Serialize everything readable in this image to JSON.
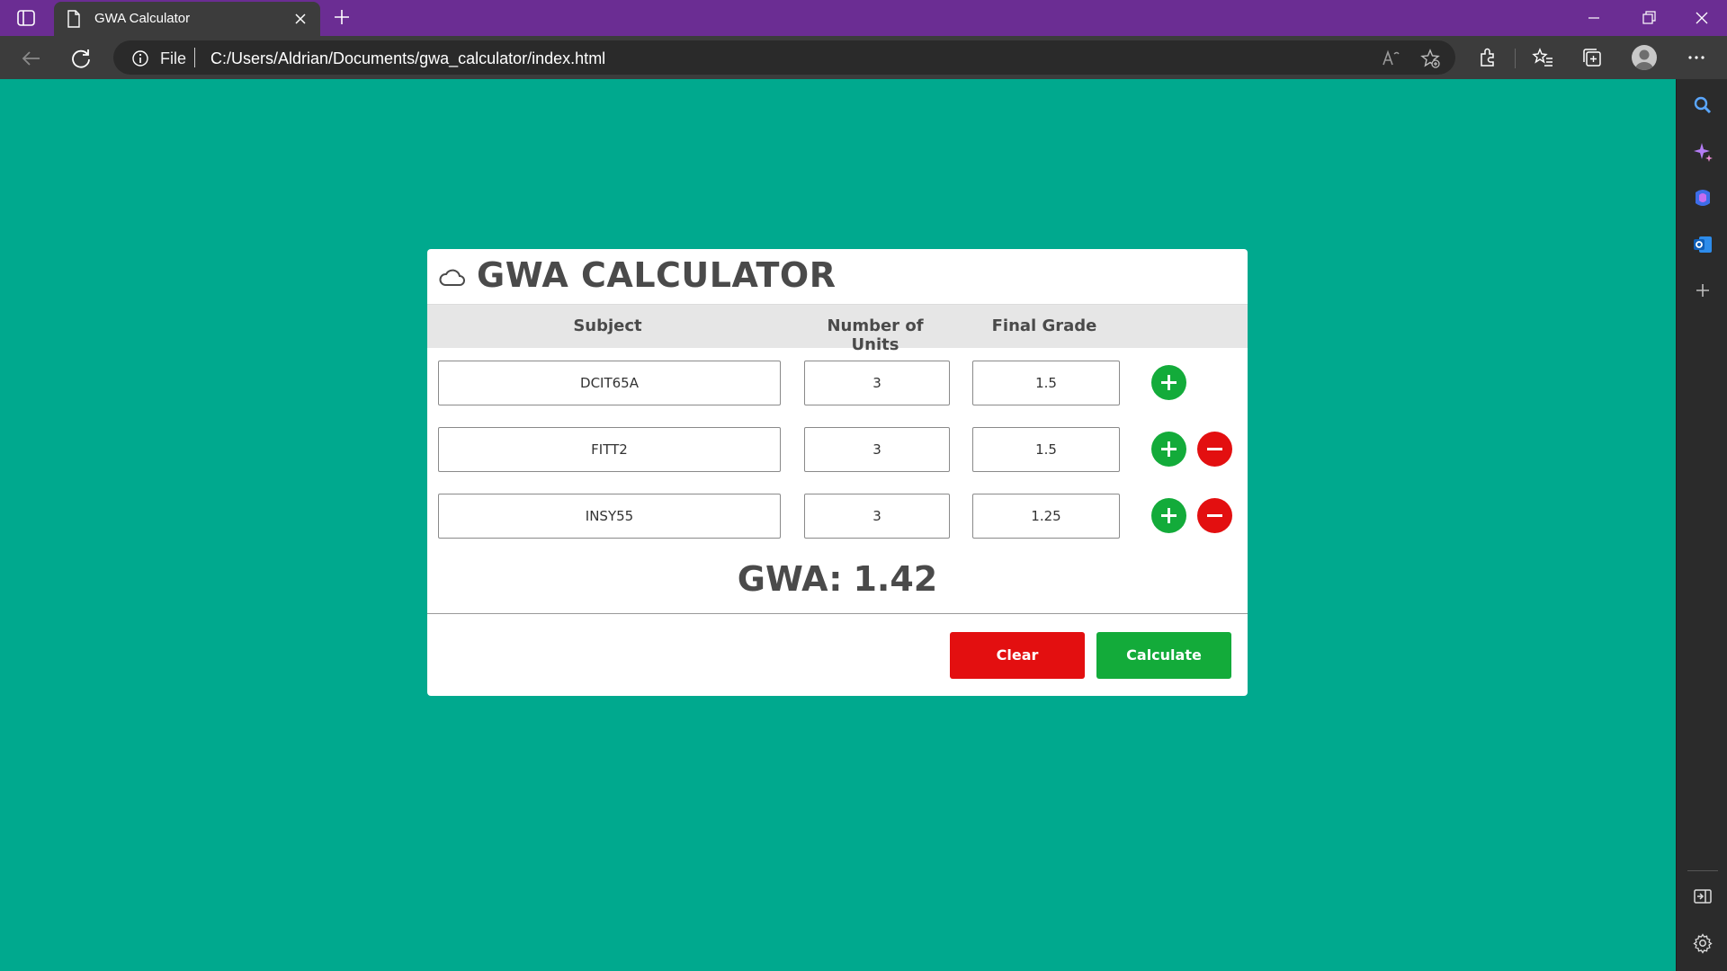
{
  "browser": {
    "tab_title": "GWA Calculator",
    "address_scheme": "File",
    "address_url": "C:/Users/Aldrian/Documents/gwa_calculator/index.html"
  },
  "app": {
    "title": "GWA CALCULATOR",
    "columns": {
      "subject": "Subject",
      "units": "Number of Units",
      "grade": "Final Grade"
    },
    "rows": [
      {
        "subject": "DCIT65A",
        "units": "3",
        "grade": "1.5",
        "removable": false
      },
      {
        "subject": "FITT2",
        "units": "3",
        "grade": "1.5",
        "removable": true
      },
      {
        "subject": "INSY55",
        "units": "3",
        "grade": "1.25",
        "removable": true
      }
    ],
    "gwa_label": "GWA:",
    "gwa_value": "1.42",
    "clear_label": "Clear",
    "calculate_label": "Calculate"
  },
  "colors": {
    "page_background": "#00a98e",
    "tab_bar": "#6b2d93",
    "add_button": "#13ab3a",
    "remove_button": "#e30f10"
  },
  "icons": {
    "title": "cloud-icon",
    "add": "plus-circle-icon",
    "remove": "minus-circle-icon"
  }
}
